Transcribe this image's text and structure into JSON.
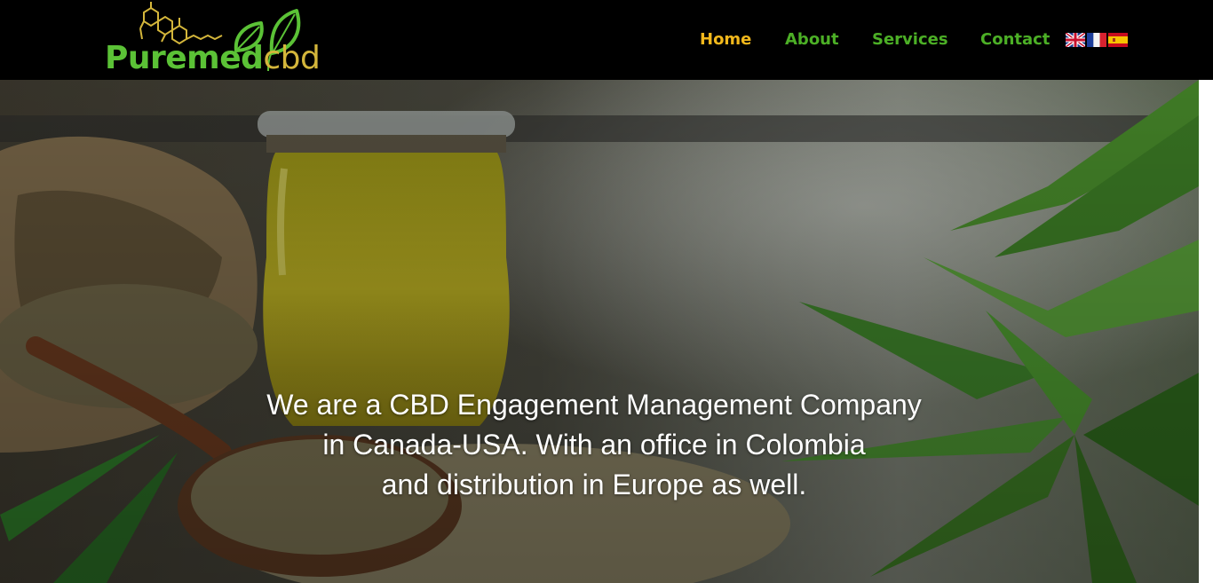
{
  "logo": {
    "brand_main": "Puremed",
    "brand_suffix": "cbd",
    "colors": {
      "green": "#5bc236",
      "gold": "#d4b63b"
    }
  },
  "nav": {
    "items": [
      {
        "label": "Home",
        "active": true
      },
      {
        "label": "About",
        "active": false
      },
      {
        "label": "Services",
        "active": false
      },
      {
        "label": "Contact",
        "active": false
      }
    ],
    "colors": {
      "default": "#4caf26",
      "active": "#f2b81c"
    }
  },
  "languages": [
    {
      "icon": "uk-flag-icon",
      "code": "en"
    },
    {
      "icon": "france-flag-icon",
      "code": "fr"
    },
    {
      "icon": "spain-flag-icon",
      "code": "es"
    }
  ],
  "hero": {
    "lines": [
      "We are a CBD Engagement Management Company",
      "in Canada-USA. With an office in Colombia",
      "and distribution in Europe as well."
    ]
  }
}
